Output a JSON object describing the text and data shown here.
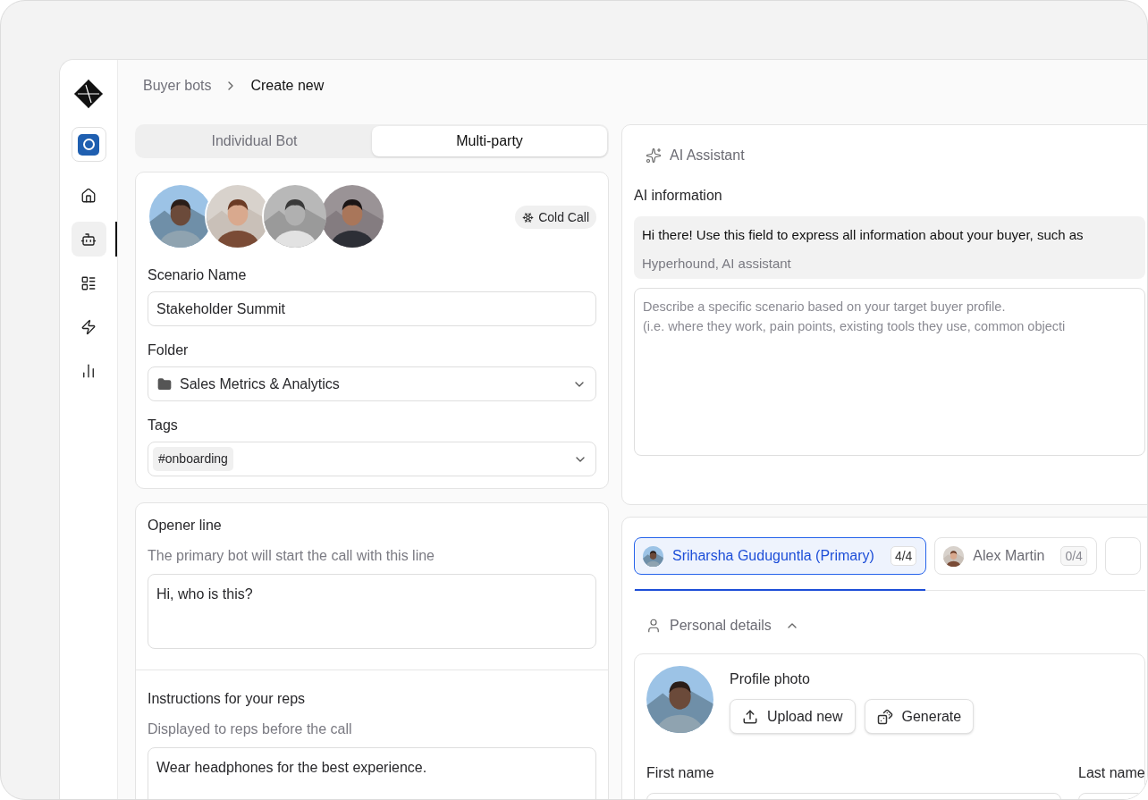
{
  "sidebar": {
    "items": [
      {
        "kind": "home",
        "selected": false
      },
      {
        "kind": "bot",
        "selected": true
      },
      {
        "kind": "list",
        "selected": false
      },
      {
        "kind": "bolt",
        "selected": false
      },
      {
        "kind": "chart",
        "selected": false
      }
    ]
  },
  "breadcrumb": [
    "Buyer bots",
    "Create new"
  ],
  "mode_tabs": [
    {
      "label": "Individual Bot",
      "selected": false
    },
    {
      "label": "Multi-party",
      "selected": true
    }
  ],
  "call_type": "Cold Call",
  "scenario": {
    "label": "Scenario Name",
    "value": "Stakeholder Summit"
  },
  "folder": {
    "label": "Folder",
    "value": "Sales Metrics & Analytics"
  },
  "tags": {
    "label": "Tags",
    "items": [
      "#onboarding"
    ]
  },
  "opener": {
    "title": "Opener line",
    "description": "The primary bot will start the call with this line",
    "value": "Hi, who is this?"
  },
  "instructions": {
    "title": "Instructions for your reps",
    "description": "Displayed to reps before the call",
    "value": "Wear headphones for the best experience."
  },
  "assistant": {
    "title": "AI Assistant",
    "label": "AI information",
    "message": "Hi there! Use this field to express all information about your buyer, such as",
    "author": "Hyperhound, AI assistant",
    "placeholder": "Describe a specific scenario based on your target buyer profile.\n(i.e. where they work, pain points, existing tools they use, common objecti"
  },
  "bot_tabs": [
    {
      "name": "Sriharsha Guduguntla (Primary)",
      "count": "4/4",
      "selected": true
    },
    {
      "name": "Alex Martin",
      "count": "0/4",
      "selected": false
    }
  ],
  "personal_details": {
    "title": "Personal details",
    "expanded": true,
    "photo_label": "Profile photo",
    "buttons": [
      "Upload new",
      "Generate"
    ],
    "first_name": {
      "label": "First name"
    },
    "last_name": {
      "label": "Last name"
    }
  }
}
